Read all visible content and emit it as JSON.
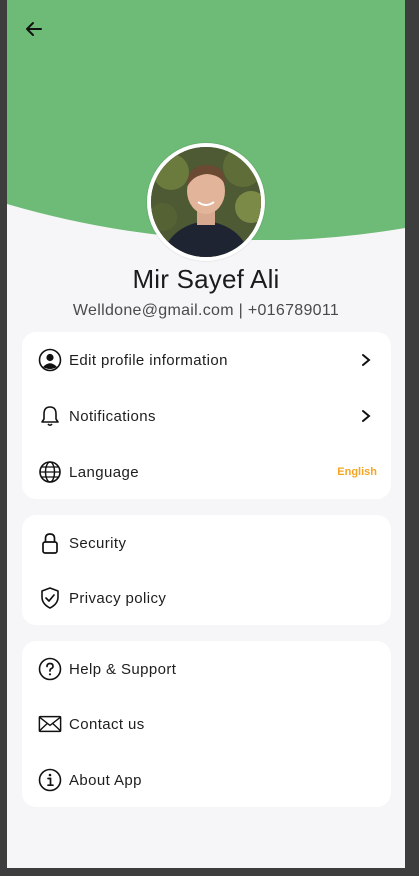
{
  "header": {
    "back_icon": "arrow-left-icon",
    "bg_color": "#6dbb76"
  },
  "profile": {
    "name": "Mir Sayef Ali",
    "contact": "Welldone@gmail.com | +016789011",
    "avatar": "user-avatar-photo"
  },
  "sections": [
    {
      "items": [
        {
          "label": "Edit profile information",
          "icon": "user-circle-icon",
          "trailing": "chevron-right-icon"
        },
        {
          "label": "Notifications",
          "icon": "bell-icon",
          "trailing": "chevron-right-icon"
        },
        {
          "label": "Language",
          "icon": "globe-icon",
          "value": "English"
        }
      ]
    },
    {
      "items": [
        {
          "label": "Security",
          "icon": "lock-icon"
        },
        {
          "label": "Privacy policy",
          "icon": "shield-check-icon"
        }
      ]
    },
    {
      "items": [
        {
          "label": "Help & Support",
          "icon": "question-circle-icon"
        },
        {
          "label": "Contact us",
          "icon": "mail-icon"
        },
        {
          "label": "About App",
          "icon": "info-circle-icon"
        }
      ]
    }
  ],
  "colors": {
    "accent": "#6dbb76",
    "language_value": "#f5a524",
    "background": "#f6f6f8"
  }
}
